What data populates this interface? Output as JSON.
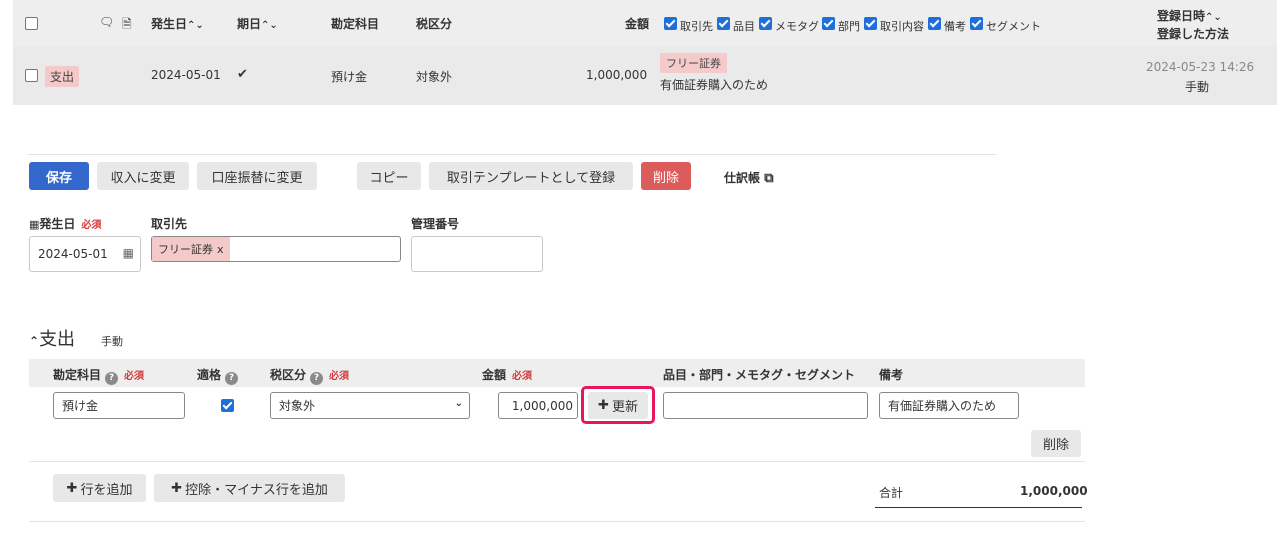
{
  "list": {
    "headers": {
      "date": "発生日",
      "due": "期日",
      "account": "勘定科目",
      "tax": "税区分",
      "amount": "金額",
      "registered_at": "登録日時",
      "registered_method": "登録した方法"
    },
    "filters": [
      "取引先",
      "品目",
      "メモタグ",
      "部門",
      "取引内容",
      "備考",
      "セグメント"
    ],
    "row": {
      "type": "支出",
      "date": "2024-05-01",
      "due_mark": "✔",
      "account": "預け金",
      "tax": "対象外",
      "amount": "1,000,000",
      "partner_tag": "フリー証券",
      "description": "有価証券購入のため",
      "registered_at": "2024-05-23 14:26",
      "registered_method": "手動"
    }
  },
  "toolbar": {
    "save": "保存",
    "to_income": "収入に変更",
    "to_transfer": "口座振替に変更",
    "copy": "コピー",
    "as_template": "取引テンプレートとして登録",
    "delete": "削除",
    "journal": "仕訳帳"
  },
  "form": {
    "date_label": "発生日",
    "required": "必須",
    "date_value": "2024-05-01",
    "partner_label": "取引先",
    "partner_tag": "フリー証券",
    "partner_remove": "x",
    "mgmt_label": "管理番号",
    "mgmt_value": ""
  },
  "section": {
    "title": "支出",
    "subtitle": "手動"
  },
  "lines": {
    "headers": {
      "account": "勘定科目",
      "qualified": "適格",
      "tax": "税区分",
      "amount": "金額",
      "items": "品目・部門・メモタグ・セグメント",
      "notes": "備考"
    },
    "row": {
      "account": "預け金",
      "qualified_checked": true,
      "tax": "対象外",
      "amount": "1,000,000",
      "update_button": "更新",
      "items": "",
      "notes": "有価証券購入のため",
      "delete": "削除"
    },
    "add_row": "行を追加",
    "add_minus_row": "控除・マイナス行を追加",
    "total_label": "合計",
    "total_value": "1,000,000"
  },
  "colors": {
    "primary": "#3367cc",
    "danger": "#dc5c5c",
    "highlight": "#e8175d",
    "checkbox": "#1e6fd9"
  }
}
